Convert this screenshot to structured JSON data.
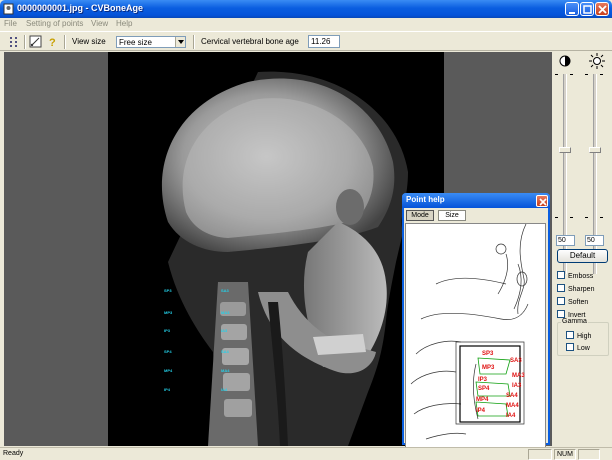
{
  "window": {
    "title": "0000000001.jpg - CVBoneAge"
  },
  "menu": [
    "File",
    "Setting of points",
    "View",
    "Help"
  ],
  "toolbar": {
    "view_size_label": "View size",
    "view_size_value": "Free size",
    "bone_age_label": "Cervical vertebral bone age",
    "bone_age_value": "11.26"
  },
  "xray_labels": {
    "left_column": [
      "SP3",
      "MP3",
      "IP3",
      "SP4",
      "MP4",
      "IP4"
    ],
    "right_column": [
      "SA3",
      "MA3",
      "IA3",
      "SA4",
      "MA4",
      "IA4"
    ]
  },
  "panel": {
    "contrast_value": "50",
    "brightness_value": "50",
    "default_label": "Default",
    "checkboxes": [
      "Emboss",
      "Sharpen",
      "Soften",
      "Invert"
    ],
    "gamma": {
      "legend": "Gamma",
      "options": [
        "High",
        "Low"
      ]
    }
  },
  "point_help": {
    "title": "Point help",
    "tabs": [
      "Mode",
      "Size"
    ],
    "labels": {
      "sp3": "SP3",
      "sa3": "SA3",
      "mp3": "MP3",
      "ma3": "MA3",
      "ip3": "IP3",
      "ia3": "IA3",
      "sp4": "SP4",
      "sa4": "SA4",
      "mp4": "MP4",
      "ma4": "MA4",
      "ip4": "IP4",
      "ia4": "IA4"
    }
  },
  "status": {
    "text": "Ready",
    "num": "NUM"
  }
}
